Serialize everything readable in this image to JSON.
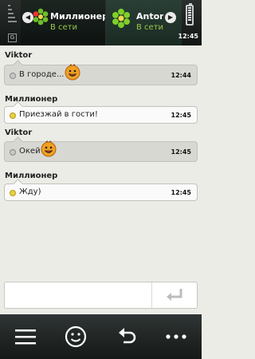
{
  "header": {
    "indicator": "G",
    "tabs": [
      {
        "name": "Миллионер",
        "status": "В сети"
      },
      {
        "name": "Anton(",
        "status": "В сети"
      }
    ],
    "time": "12:45"
  },
  "messages": [
    {
      "sender": "Viktor",
      "text": "В городе...",
      "time": "12:44",
      "direction": "in",
      "emoticon": "smile-emoticon"
    },
    {
      "sender": "Миллионер",
      "text": "Приезжай в гости!",
      "time": "12:45",
      "direction": "out",
      "emoticon": ""
    },
    {
      "sender": "Viktor",
      "text": "Окей",
      "time": "12:45",
      "direction": "in",
      "emoticon": "smile-emoticon"
    },
    {
      "sender": "Миллионер",
      "text": "Жду)",
      "time": "12:45",
      "direction": "out",
      "emoticon": ""
    }
  ],
  "input": {
    "value": "",
    "placeholder": ""
  },
  "toolbar": [
    "menu-icon",
    "smiley-icon",
    "back-icon",
    "more-icon"
  ],
  "colors": {
    "online": "#9ac84a",
    "icq_green": "#6fbf2a",
    "header_bg": "#1e2422"
  }
}
